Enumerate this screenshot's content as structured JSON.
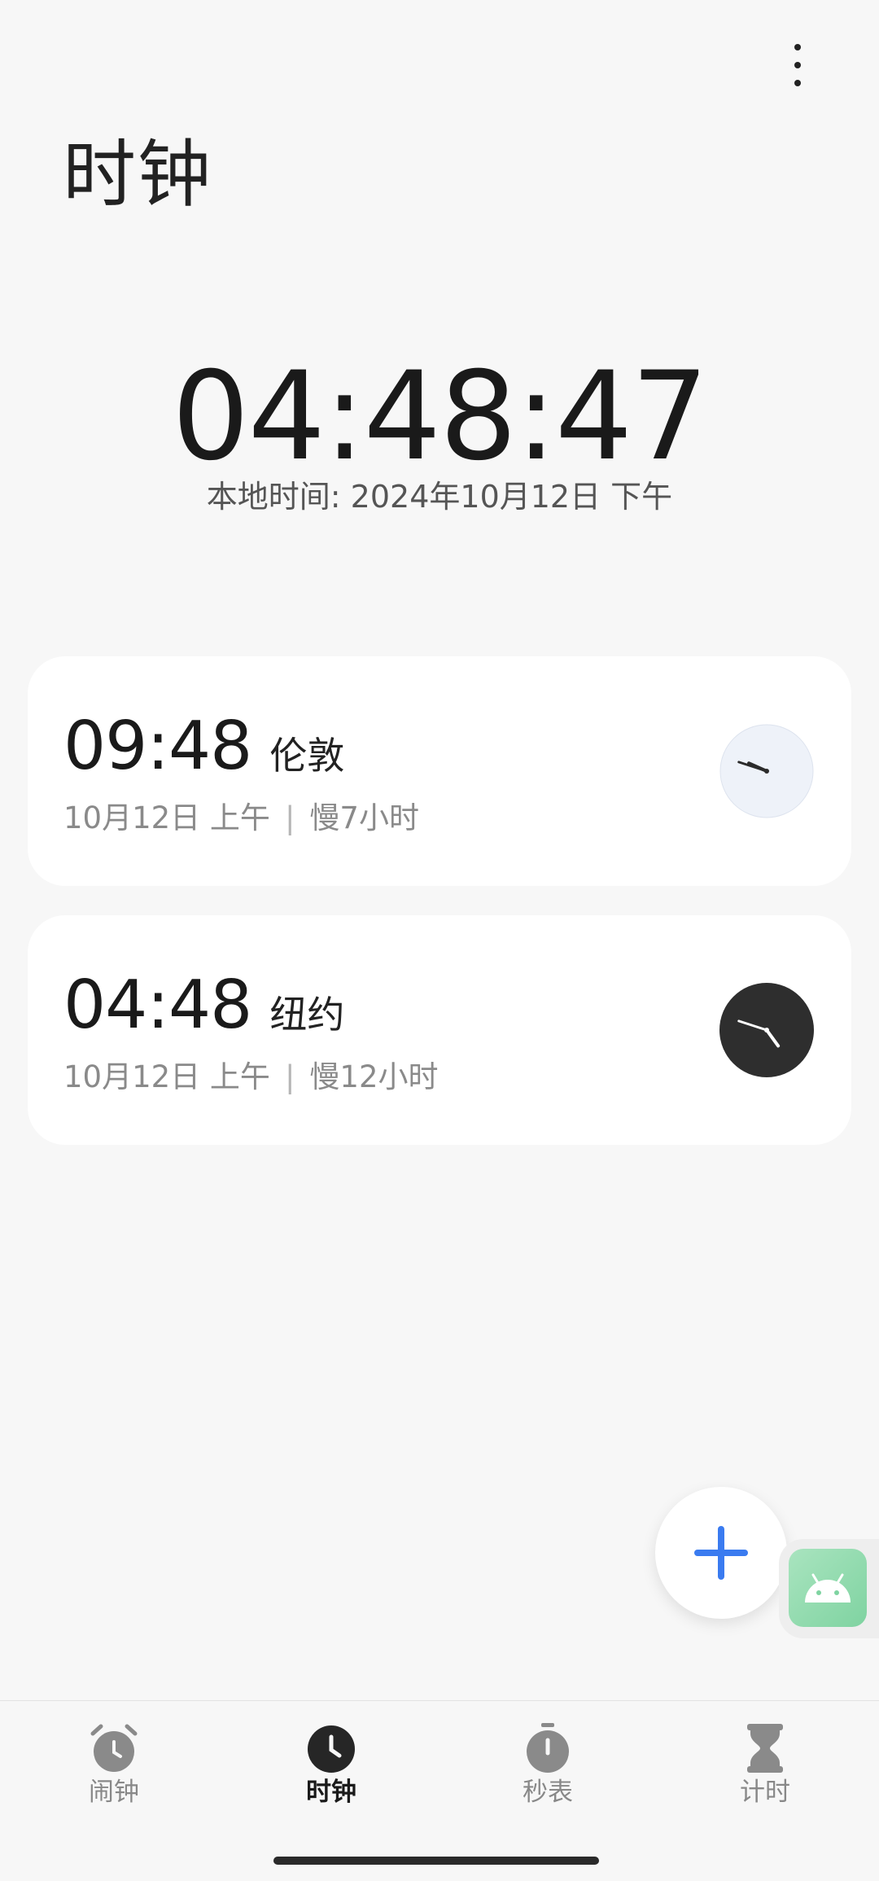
{
  "header": {
    "title": "时钟",
    "more_icon": "more-vertical-icon"
  },
  "local_clock": {
    "time": "04:48:47",
    "date_line": "本地时间: 2024年10月12日 下午"
  },
  "world_clocks": [
    {
      "time": "09:48",
      "city": "伦敦",
      "date": "10月12日 上午",
      "separator": "|",
      "offset": "慢7小时",
      "dial_theme": "light",
      "hour": 9,
      "minute": 48
    },
    {
      "time": "04:48",
      "city": "纽约",
      "date": "10月12日 上午",
      "separator": "|",
      "offset": "慢12小时",
      "dial_theme": "dark",
      "hour": 4,
      "minute": 48
    }
  ],
  "fab": {
    "icon": "plus-icon",
    "color": "#3a7bf0"
  },
  "floating_app": {
    "icon": "android-icon"
  },
  "bottom_nav": {
    "items": [
      {
        "label": "闹钟",
        "icon": "alarm-clock-icon",
        "active": false
      },
      {
        "label": "时钟",
        "icon": "clock-icon",
        "active": true
      },
      {
        "label": "秒表",
        "icon": "stopwatch-icon",
        "active": false
      },
      {
        "label": "计时",
        "icon": "hourglass-icon",
        "active": false
      }
    ]
  },
  "colors": {
    "background": "#f7f7f7",
    "card": "#ffffff",
    "accent": "#3a7bf0",
    "text_primary": "#1a1a1a",
    "text_secondary": "#8a8a8a",
    "nav_inactive": "#888888"
  }
}
